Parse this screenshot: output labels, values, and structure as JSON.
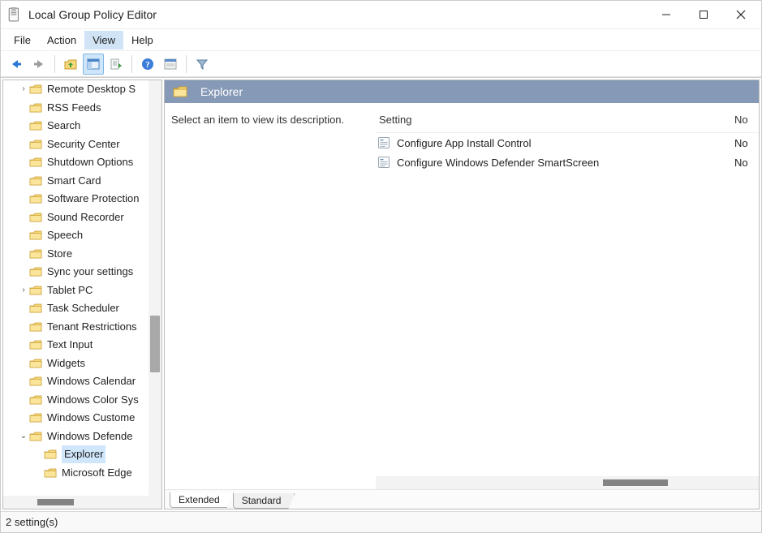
{
  "window": {
    "title": "Local Group Policy Editor"
  },
  "menu": {
    "file": "File",
    "action": "Action",
    "view": "View",
    "help": "Help"
  },
  "tree": {
    "items": [
      {
        "label": "Remote Desktop S",
        "expander": "›",
        "indent": 1
      },
      {
        "label": "RSS Feeds",
        "expander": "",
        "indent": 1
      },
      {
        "label": "Search",
        "expander": "",
        "indent": 1
      },
      {
        "label": "Security Center",
        "expander": "",
        "indent": 1
      },
      {
        "label": "Shutdown Options",
        "expander": "",
        "indent": 1
      },
      {
        "label": "Smart Card",
        "expander": "",
        "indent": 1
      },
      {
        "label": "Software Protection",
        "expander": "",
        "indent": 1
      },
      {
        "label": "Sound Recorder",
        "expander": "",
        "indent": 1
      },
      {
        "label": "Speech",
        "expander": "",
        "indent": 1
      },
      {
        "label": "Store",
        "expander": "",
        "indent": 1
      },
      {
        "label": "Sync your settings",
        "expander": "",
        "indent": 1
      },
      {
        "label": "Tablet PC",
        "expander": "›",
        "indent": 1
      },
      {
        "label": "Task Scheduler",
        "expander": "",
        "indent": 1
      },
      {
        "label": "Tenant Restrictions",
        "expander": "",
        "indent": 1
      },
      {
        "label": "Text Input",
        "expander": "",
        "indent": 1
      },
      {
        "label": "Widgets",
        "expander": "",
        "indent": 1
      },
      {
        "label": "Windows Calendar",
        "expander": "",
        "indent": 1
      },
      {
        "label": "Windows Color Sys",
        "expander": "",
        "indent": 1
      },
      {
        "label": "Windows Custome",
        "expander": "",
        "indent": 1
      },
      {
        "label": "Windows Defende",
        "expander": "⌄",
        "indent": 1
      },
      {
        "label": "Explorer",
        "expander": "",
        "indent": 2,
        "selected": true
      },
      {
        "label": "Microsoft Edge",
        "expander": "",
        "indent": 2
      }
    ]
  },
  "detail": {
    "header_title": "Explorer",
    "description": "Select an item to view its description.",
    "columns": {
      "setting": "Setting",
      "state": "No"
    },
    "settings": [
      {
        "name": "Configure App Install Control",
        "state": "No"
      },
      {
        "name": "Configure Windows Defender SmartScreen",
        "state": "No"
      }
    ],
    "tabs": {
      "extended": "Extended",
      "standard": "Standard"
    }
  },
  "status": {
    "text": "2 setting(s)"
  }
}
